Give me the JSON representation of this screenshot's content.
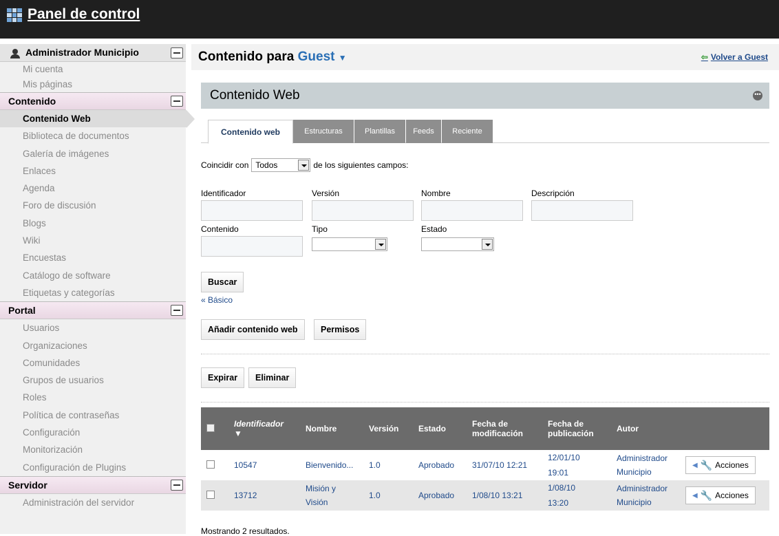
{
  "topbar": {
    "title": "Panel de control"
  },
  "sidebar": {
    "user": "Administrador Municipio",
    "user_items": [
      "Mi cuenta",
      "Mis páginas"
    ],
    "sections": [
      {
        "title": "Contenido",
        "items": [
          "Contenido Web",
          "Biblioteca de documentos",
          "Galería de imágenes",
          "Enlaces",
          "Agenda",
          "Foro de discusión",
          "Blogs",
          "Wiki",
          "Encuestas",
          "Catálogo de software",
          "Etiquetas y categorías"
        ]
      },
      {
        "title": "Portal",
        "items": [
          "Usuarios",
          "Organizaciones",
          "Comunidades",
          "Grupos de usuarios",
          "Roles",
          "Política de contraseñas",
          "Configuración",
          "Monitorización",
          "Configuración de Plugins"
        ]
      },
      {
        "title": "Servidor",
        "items": [
          "Administración del servidor"
        ]
      }
    ]
  },
  "header": {
    "title_prefix": "Contenido para",
    "scope": "Guest",
    "scope_arrow": "▼",
    "back_label": "Volver a Guest"
  },
  "portlet": {
    "title": "Contenido Web"
  },
  "tabs": [
    "Contenido web",
    "Estructuras",
    "Plantillas",
    "Feeds",
    "Reciente"
  ],
  "search": {
    "match_prefix": "Coincidir con",
    "match_value": "Todos",
    "match_suffix": "de los siguientes campos:",
    "labels": {
      "id": "Identificador",
      "version": "Versión",
      "name": "Nombre",
      "description": "Descripción",
      "content": "Contenido",
      "type": "Tipo",
      "status": "Estado"
    },
    "search_button": "Buscar",
    "basic_link": "« Básico"
  },
  "actions": {
    "add": "Añadir contenido web",
    "permissions": "Permisos",
    "expire": "Expirar",
    "delete": "Eliminar"
  },
  "table": {
    "headers": [
      "Identificador",
      "Nombre",
      "Versión",
      "Estado",
      "Fecha de modificación",
      "Fecha de publicación",
      "Autor"
    ],
    "sort_arrow": "▼",
    "rows": [
      {
        "id": "10547",
        "name": "Bienvenido...",
        "version": "1.0",
        "status": "Aprobado",
        "modified": "31/07/10 12:21",
        "published": "12/01/10 19:01",
        "author": "Administrador Municipio",
        "action": "Acciones"
      },
      {
        "id": "13712",
        "name": "Misión y Visión",
        "version": "1.0",
        "status": "Aprobado",
        "modified": "1/08/10 13:21",
        "published": "1/08/10 13:20",
        "author": "Administrador Municipio",
        "action": "Acciones"
      }
    ]
  },
  "footer": {
    "results": "Mostrando 2 resultados."
  }
}
